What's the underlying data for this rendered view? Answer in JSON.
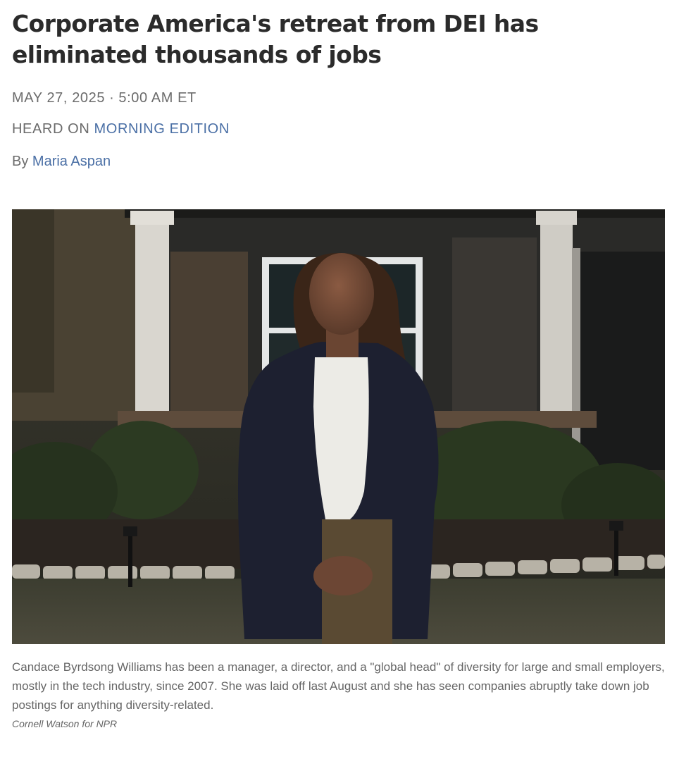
{
  "article": {
    "headline": "Corporate America's retreat from DEI has eliminated thousands of jobs",
    "date": "MAY 27, 2025",
    "separator": "·",
    "time": "5:00 AM ET",
    "heard_on_prefix": "HEARD ON",
    "program": "MORNING EDITION",
    "byline_prefix": "By",
    "author": "Maria Aspan"
  },
  "photo": {
    "caption": "Candace Byrdsong Williams has been a manager, a director, and a \"global head\" of diversity for large and small employers, mostly in the tech industry, since 2007. She was laid off last August and she has seen companies abruptly take down job postings for anything diversity-related.",
    "credit": "Cornell Watson for NPR"
  },
  "colors": {
    "link": "#4a6fa5",
    "headline": "#2b2b2b",
    "meta": "#6b6b6b"
  }
}
